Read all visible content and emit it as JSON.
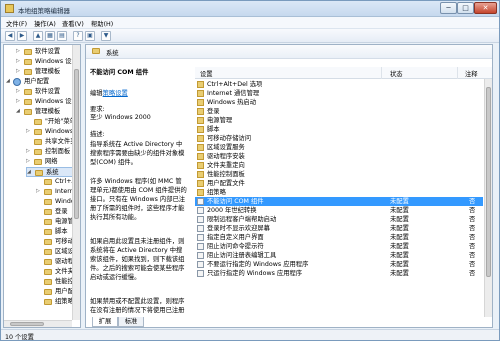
{
  "window": {
    "title": "本地组策略编辑器",
    "buttons": {
      "min": "─",
      "max": "□",
      "close": "✕"
    }
  },
  "menubar": {
    "items": [
      "文件(F)",
      "操作(A)",
      "查看(V)",
      "帮助(H)"
    ]
  },
  "toolbar": {
    "buttons": [
      {
        "icon": "back-arrow-icon",
        "glyph": "◀"
      },
      {
        "icon": "forward-arrow-icon",
        "glyph": "▶"
      },
      {
        "icon": "up-folder-icon",
        "glyph": "▲"
      },
      {
        "icon": "show-tree-icon",
        "glyph": "▦"
      },
      {
        "icon": "export-list-icon",
        "glyph": "▤"
      },
      {
        "icon": "help-icon",
        "glyph": "?"
      },
      {
        "icon": "properties-icon",
        "glyph": "▣"
      },
      {
        "icon": "filter-icon",
        "glyph": "▼"
      }
    ]
  },
  "tree": {
    "items": [
      {
        "label": "软件设置",
        "icon": "folder"
      },
      {
        "label": "Windows 设置",
        "icon": "folder"
      },
      {
        "label": "管理模板",
        "icon": "folder"
      },
      {
        "label": "用户配置",
        "icon": "user"
      },
      {
        "label": "软件设置",
        "icon": "folder"
      },
      {
        "label": "Windows 设置",
        "icon": "folder"
      },
      {
        "label": "管理模板",
        "icon": "folder"
      },
      {
        "label": "\"开始\"菜单和任务栏",
        "icon": "folder"
      },
      {
        "label": "Windows 组件",
        "icon": "folder"
      },
      {
        "label": "共享文件夹",
        "icon": "folder"
      },
      {
        "label": "控制面板",
        "icon": "folder"
      },
      {
        "label": "网络",
        "icon": "folder"
      },
      {
        "label": "系统",
        "icon": "folder"
      },
      {
        "label": "Ctrl+Alt+Del 选项",
        "icon": "folder"
      },
      {
        "label": "Internet 通信管理",
        "icon": "folder"
      },
      {
        "label": "Windows 热启动",
        "icon": "folder"
      },
      {
        "label": "登录",
        "icon": "folder"
      },
      {
        "label": "电源管理",
        "icon": "folder"
      },
      {
        "label": "脚本",
        "icon": "folder"
      },
      {
        "label": "可移动存储访问",
        "icon": "folder"
      },
      {
        "label": "区域设置服务",
        "icon": "folder"
      },
      {
        "label": "驱动程序安装",
        "icon": "folder"
      },
      {
        "label": "文件夹重定向",
        "icon": "folder"
      },
      {
        "label": "性能控制面板",
        "icon": "folder"
      },
      {
        "label": "用户配置文件",
        "icon": "folder"
      },
      {
        "label": "组策略",
        "icon": "folder"
      }
    ]
  },
  "main": {
    "folder_label": "系统",
    "description": {
      "title": "不能访问 COM 组件",
      "edit_prefix": "编辑",
      "edit_link": "策略设置",
      "req_label": "要求:",
      "req_value": "至少 Windows 2000",
      "desc_label": "描述:",
      "p1": "指导系统在 Active Directory 中搜索程序需要由缺少的组件对象模型(COM) 组件。",
      "p2": "许多 Windows 程序(如 MMC 管理单元)都使用由 COM 组件提供的接口。只有在 Windows 内部已注册了所需的组件时，这些程序才能执行其所有功能。",
      "p3": "如果启用此设置且未注册组件，则系统将在 Active Directory 中搜索该组件，如果找到，则下载该组件。之后的搜索可能会使某些程序启动或运行缓慢。",
      "p4": "如果禁用或不配置此设置，则程序在没有注册的情况下将使用已注册的组件，"
    },
    "columns": {
      "setting": "设置",
      "state": "状态",
      "note": "注释"
    },
    "rows": [
      {
        "name": "Ctrl+Alt+Del 选项",
        "state": "",
        "note": "",
        "kind": "folder"
      },
      {
        "name": "Internet 通信管理",
        "state": "",
        "note": "",
        "kind": "folder"
      },
      {
        "name": "Windows 热启动",
        "state": "",
        "note": "",
        "kind": "folder"
      },
      {
        "name": "登录",
        "state": "",
        "note": "",
        "kind": "folder"
      },
      {
        "name": "电源管理",
        "state": "",
        "note": "",
        "kind": "folder"
      },
      {
        "name": "脚本",
        "state": "",
        "note": "",
        "kind": "folder"
      },
      {
        "name": "可移动存储访问",
        "state": "",
        "note": "",
        "kind": "folder"
      },
      {
        "name": "区域设置服务",
        "state": "",
        "note": "",
        "kind": "folder"
      },
      {
        "name": "驱动程序安装",
        "state": "",
        "note": "",
        "kind": "folder"
      },
      {
        "name": "文件夹重定向",
        "state": "",
        "note": "",
        "kind": "folder"
      },
      {
        "name": "性能控制面板",
        "state": "",
        "note": "",
        "kind": "folder"
      },
      {
        "name": "用户配置文件",
        "state": "",
        "note": "",
        "kind": "folder"
      },
      {
        "name": "组策略",
        "state": "",
        "note": "",
        "kind": "folder"
      },
      {
        "name": "不能访问 COM 组件",
        "state": "未配置",
        "note": "否",
        "kind": "policy",
        "selected": true
      },
      {
        "name": "2000 年世纪转换",
        "state": "未配置",
        "note": "否",
        "kind": "policy"
      },
      {
        "name": "限制远程客户端帮助启动",
        "state": "未配置",
        "note": "否",
        "kind": "policy"
      },
      {
        "name": "登录时不显示欢迎屏幕",
        "state": "未配置",
        "note": "否",
        "kind": "policy"
      },
      {
        "name": "指定自定义用户界面",
        "state": "未配置",
        "note": "否",
        "kind": "policy"
      },
      {
        "name": "阻止访问命令提示符",
        "state": "未配置",
        "note": "否",
        "kind": "policy"
      },
      {
        "name": "阻止访问注册表编辑工具",
        "state": "未配置",
        "note": "否",
        "kind": "policy"
      },
      {
        "name": "不要运行指定的 Windows 应用程序",
        "state": "未配置",
        "note": "否",
        "kind": "policy"
      },
      {
        "name": "只运行指定的 Windows 应用程序",
        "state": "未配置",
        "note": "否",
        "kind": "policy"
      }
    ],
    "tabs": [
      "扩展",
      "标准"
    ]
  },
  "status": {
    "text": "10 个设置"
  },
  "colors": {
    "selection": "#3399ff",
    "link": "#0066cc",
    "folder": "#e9cd72"
  }
}
